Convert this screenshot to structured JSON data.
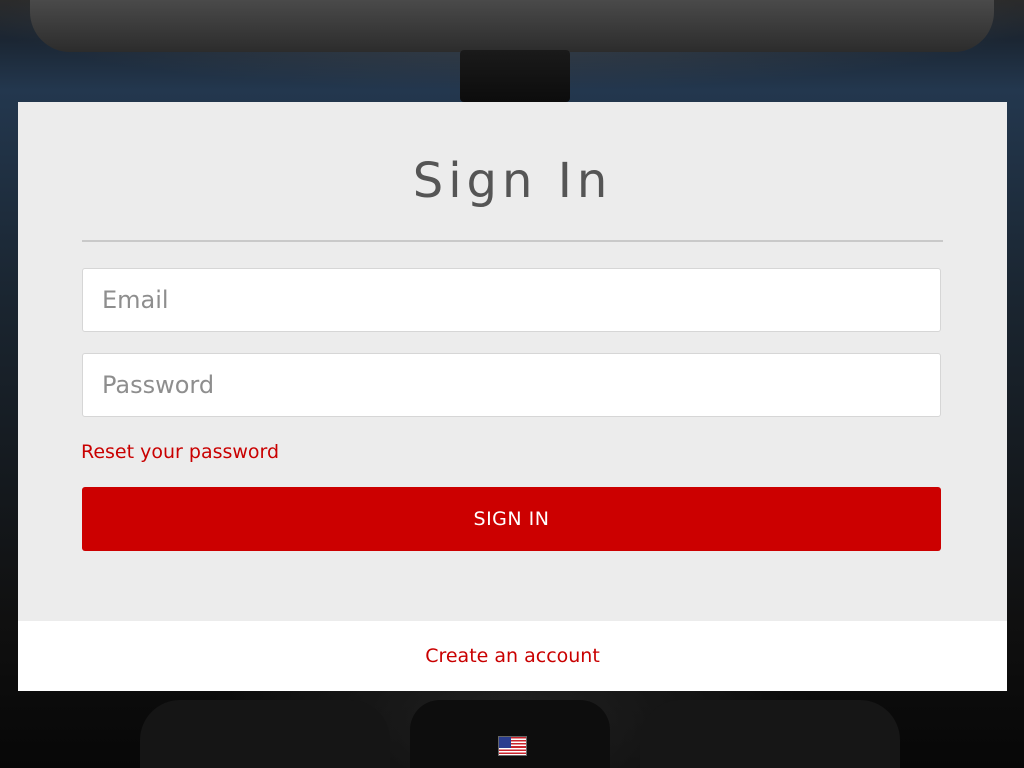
{
  "signin": {
    "title": "Sign In",
    "email_placeholder": "Email",
    "password_placeholder": "Password",
    "reset_link": "Reset your password",
    "submit_label": "SIGN IN"
  },
  "footer": {
    "create_account_link": "Create an account"
  },
  "locale": {
    "flag_icon": "us-flag-icon"
  },
  "colors": {
    "accent": "#cc0000",
    "card_background": "#ececec",
    "footer_background": "#ffffff"
  }
}
